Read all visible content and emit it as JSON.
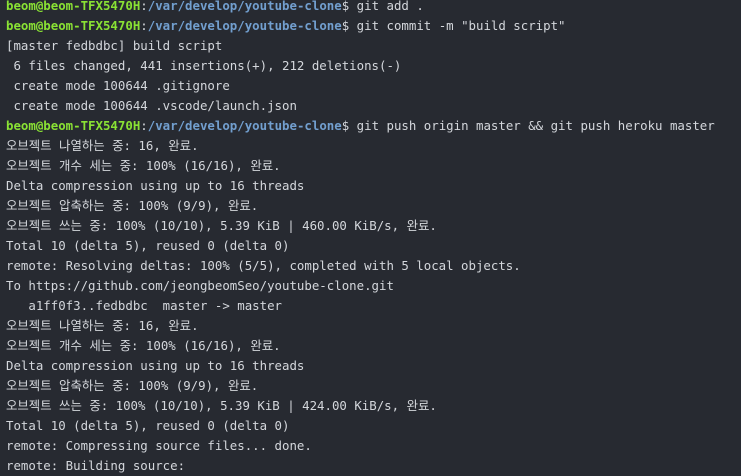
{
  "colors": {
    "background": "#272a31",
    "text": "#d4d7dc",
    "prompt_user": "#8ae234",
    "prompt_path": "#729fcf"
  },
  "prompt": {
    "user_host": "beom@beom-TFX5470H",
    "separator": ":",
    "path": "/var/develop/youtube-clone",
    "symbol": "$"
  },
  "lines": [
    {
      "type": "prompt",
      "command": " git add ."
    },
    {
      "type": "prompt",
      "command": " git commit -m \"build script\""
    },
    {
      "type": "output",
      "text": "[master fedbdbc] build script"
    },
    {
      "type": "output",
      "text": " 6 files changed, 441 insertions(+), 212 deletions(-)"
    },
    {
      "type": "output",
      "text": " create mode 100644 .gitignore"
    },
    {
      "type": "output",
      "text": " create mode 100644 .vscode/launch.json"
    },
    {
      "type": "prompt",
      "command": " git push origin master && git push heroku master"
    },
    {
      "type": "output",
      "text": "오브젝트 나열하는 중: 16, 완료."
    },
    {
      "type": "output",
      "text": "오브젝트 개수 세는 중: 100% (16/16), 완료."
    },
    {
      "type": "output",
      "text": "Delta compression using up to 16 threads"
    },
    {
      "type": "output",
      "text": "오브젝트 압축하는 중: 100% (9/9), 완료."
    },
    {
      "type": "output",
      "text": "오브젝트 쓰는 중: 100% (10/10), 5.39 KiB | 460.00 KiB/s, 완료."
    },
    {
      "type": "output",
      "text": "Total 10 (delta 5), reused 0 (delta 0)"
    },
    {
      "type": "output",
      "text": "remote: Resolving deltas: 100% (5/5), completed with 5 local objects."
    },
    {
      "type": "output",
      "text": "To https://github.com/jeongbeomSeo/youtube-clone.git"
    },
    {
      "type": "output",
      "text": "   a1ff0f3..fedbdbc  master -> master"
    },
    {
      "type": "output",
      "text": "오브젝트 나열하는 중: 16, 완료."
    },
    {
      "type": "output",
      "text": "오브젝트 개수 세는 중: 100% (16/16), 완료."
    },
    {
      "type": "output",
      "text": "Delta compression using up to 16 threads"
    },
    {
      "type": "output",
      "text": "오브젝트 압축하는 중: 100% (9/9), 완료."
    },
    {
      "type": "output",
      "text": "오브젝트 쓰는 중: 100% (10/10), 5.39 KiB | 424.00 KiB/s, 완료."
    },
    {
      "type": "output",
      "text": "Total 10 (delta 5), reused 0 (delta 0)"
    },
    {
      "type": "output",
      "text": "remote: Compressing source files... done."
    },
    {
      "type": "output",
      "text": "remote: Building source:"
    }
  ]
}
